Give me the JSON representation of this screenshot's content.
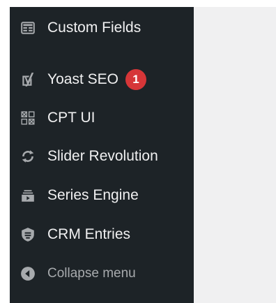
{
  "menu": {
    "items": [
      {
        "label": "Custom Fields",
        "icon": "table-icon"
      },
      {
        "label": "Yoast SEO",
        "icon": "yoast-icon",
        "badge": "1"
      },
      {
        "label": "CPT UI",
        "icon": "grid-icon"
      },
      {
        "label": "Slider Revolution",
        "icon": "refresh-icon"
      },
      {
        "label": "Series Engine",
        "icon": "media-icon"
      },
      {
        "label": "CRM Entries",
        "icon": "shield-icon"
      }
    ],
    "collapse_label": "Collapse menu",
    "collapse_icon": "collapse-arrow-icon"
  },
  "colors": {
    "sidebar_bg": "#1d2327",
    "content_bg": "#f0f0f1",
    "text": "#f0f0f1",
    "icon": "#a7aaad",
    "badge": "#d63638"
  }
}
